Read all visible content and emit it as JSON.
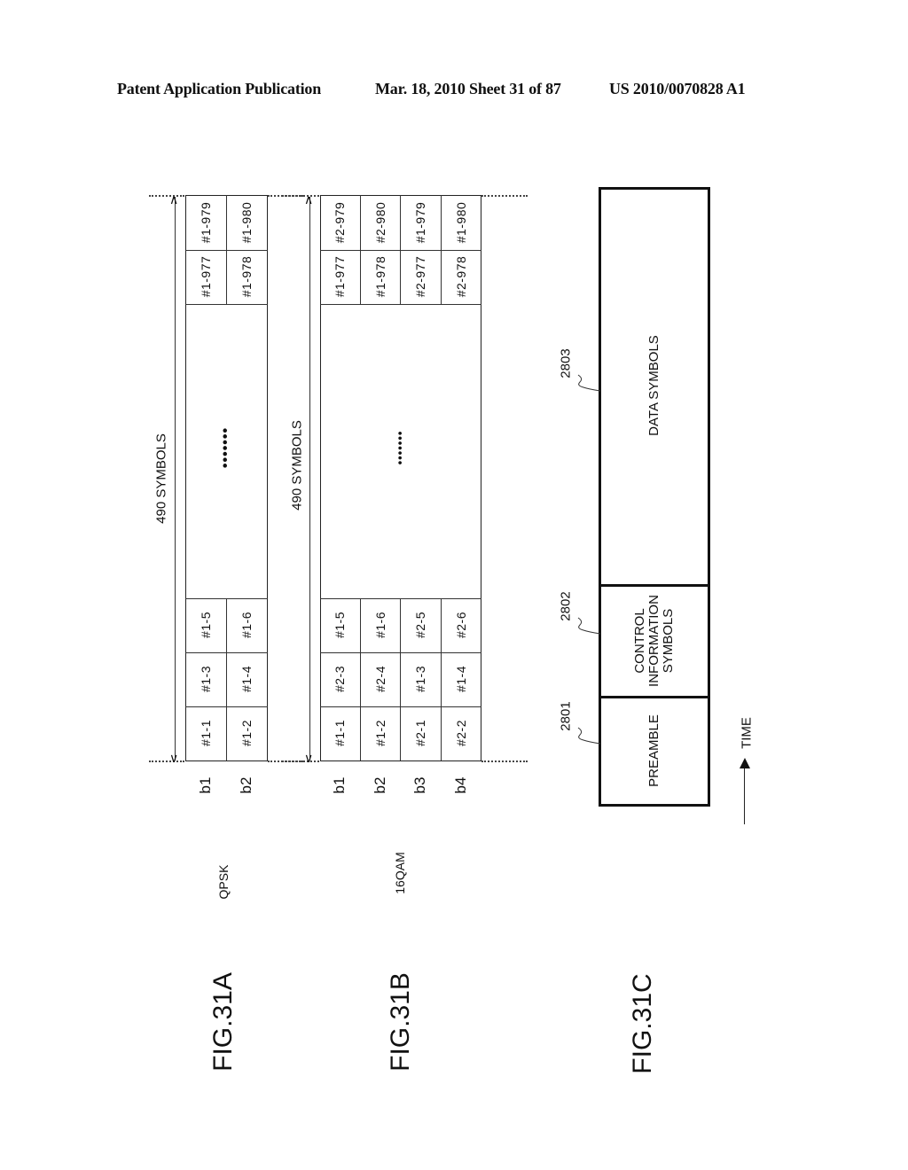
{
  "header": {
    "publication": "Patent Application Publication",
    "date_sheet": "Mar. 18, 2010  Sheet 31 of 87",
    "number": "US 2010/0070828 A1"
  },
  "fig31a": {
    "label": "FIG.31A",
    "modulation": "QPSK",
    "span_label": "490 SYMBOLS",
    "ellipsis": "•••••••",
    "rows": [
      "b1",
      "b2"
    ],
    "start_cells": [
      [
        "#1-1",
        "#1-3",
        "#1-5"
      ],
      [
        "#1-2",
        "#1-4",
        "#1-6"
      ]
    ],
    "end_cells": [
      [
        "#1-977",
        "#1-979"
      ],
      [
        "#1-978",
        "#1-980"
      ]
    ]
  },
  "fig31b": {
    "label": "FIG.31B",
    "modulation": "16QAM",
    "span_label": "490 SYMBOLS",
    "ellipsis": "•••••••",
    "rows": [
      "b1",
      "b2",
      "b3",
      "b4"
    ],
    "start_cells": [
      [
        "#1-1",
        "#2-3",
        "#1-5"
      ],
      [
        "#1-2",
        "#2-4",
        "#1-6"
      ],
      [
        "#2-1",
        "#1-3",
        "#2-5"
      ],
      [
        "#2-2",
        "#1-4",
        "#2-6"
      ]
    ],
    "end_cells": [
      [
        "#1-977",
        "#2-979"
      ],
      [
        "#1-978",
        "#2-980"
      ],
      [
        "#2-977",
        "#1-979"
      ],
      [
        "#2-978",
        "#1-980"
      ]
    ]
  },
  "fig31c": {
    "label": "FIG.31C",
    "blocks": [
      {
        "ref": "2801",
        "text": "PREAMBLE"
      },
      {
        "ref": "2802",
        "text": "CONTROL\nINFORMATION\nSYMBOLS"
      },
      {
        "ref": "2803",
        "text": "DATA SYMBOLS"
      }
    ],
    "time_label": "TIME"
  }
}
